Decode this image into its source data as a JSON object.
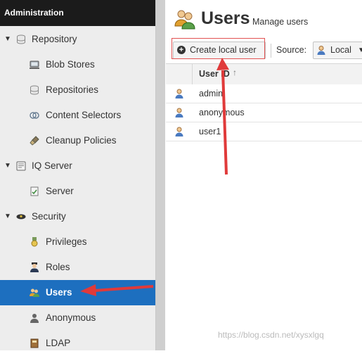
{
  "sidebar": {
    "header": "Administration",
    "items": [
      {
        "label": "Repository",
        "icon": "database-icon",
        "kind": "group"
      },
      {
        "label": "Blob Stores",
        "icon": "server-icon",
        "kind": "child"
      },
      {
        "label": "Repositories",
        "icon": "database-icon",
        "kind": "child"
      },
      {
        "label": "Content Selectors",
        "icon": "selector-icon",
        "kind": "child"
      },
      {
        "label": "Cleanup Policies",
        "icon": "brush-icon",
        "kind": "child"
      },
      {
        "label": "IQ Server",
        "icon": "certificate-icon",
        "kind": "group"
      },
      {
        "label": "Server",
        "icon": "document-check-icon",
        "kind": "child"
      },
      {
        "label": "Security",
        "icon": "police-hat-icon",
        "kind": "group"
      },
      {
        "label": "Privileges",
        "icon": "medal-icon",
        "kind": "child"
      },
      {
        "label": "Roles",
        "icon": "officer-icon",
        "kind": "child"
      },
      {
        "label": "Users",
        "icon": "users-icon",
        "kind": "child",
        "selected": true
      },
      {
        "label": "Anonymous",
        "icon": "anonymous-icon",
        "kind": "child"
      },
      {
        "label": "LDAP",
        "icon": "book-icon",
        "kind": "child"
      }
    ]
  },
  "main": {
    "title": "Users",
    "subtitle": "Manage users",
    "toolbar": {
      "create_label": "Create local user",
      "source_label": "Source:",
      "source_value": "Local"
    },
    "grid": {
      "column_header": "User ID",
      "rows": [
        "admin",
        "anonymous",
        "user1"
      ]
    }
  },
  "watermark": "https://blog.csdn.net/xysxlgq",
  "colors": {
    "selected": "#1d6fbf",
    "header": "#1b1b1b",
    "annotation": "#e03a3a"
  }
}
